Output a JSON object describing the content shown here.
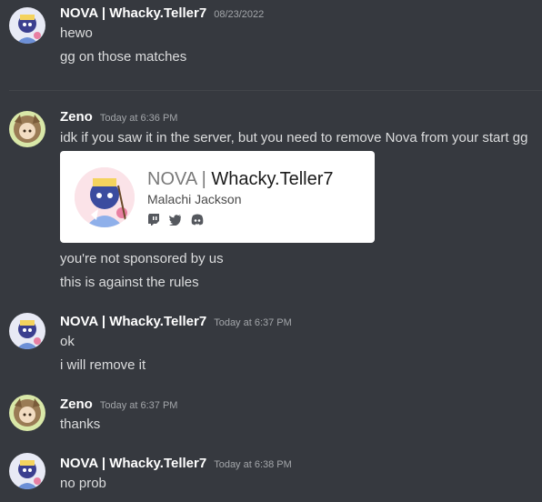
{
  "messages": [
    {
      "author": "NOVA | Whacky.Teller7",
      "timestamp": "08/23/2022",
      "lines": [
        "hewo",
        "gg on those matches"
      ]
    },
    {
      "author": "Zeno",
      "timestamp": "Today at 6:36 PM",
      "lines": [
        "idk if you saw it in the server, but you need to remove Nova from your start gg"
      ]
    },
    {
      "embed": {
        "title_prefix": "NOVA |",
        "title_name": "Whacky.Teller7",
        "subtitle": "Malachi Jackson",
        "icons": [
          "twitch-icon",
          "twitter-icon",
          "discord-icon"
        ]
      },
      "lines_after": [
        "you're not sponsored by us",
        "this is against the rules"
      ]
    },
    {
      "author": "NOVA | Whacky.Teller7",
      "timestamp": "Today at 6:37 PM",
      "lines": [
        "ok",
        "i will remove it"
      ]
    },
    {
      "author": "Zeno",
      "timestamp": "Today at 6:37 PM",
      "lines": [
        "thanks"
      ]
    },
    {
      "author": "NOVA | Whacky.Teller7",
      "timestamp": "Today at 6:38 PM",
      "lines": [
        "no prob"
      ]
    }
  ],
  "colors": {
    "background": "#36393f",
    "text": "#dcddde",
    "author": "#ffffff",
    "timestamp": "#a3a6aa",
    "embed_bg": "#ffffff"
  }
}
